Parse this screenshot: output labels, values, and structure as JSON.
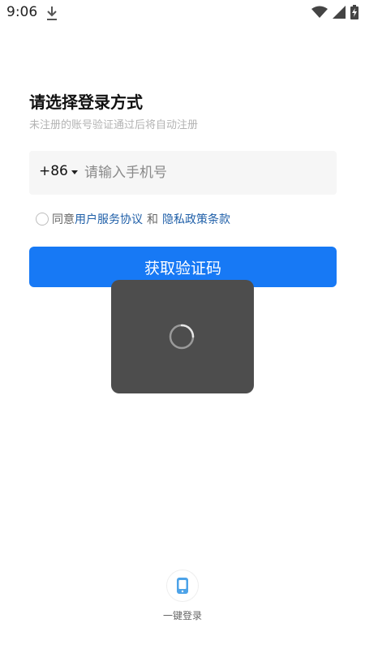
{
  "status_bar": {
    "time": "9:06",
    "icons": [
      "download-icon",
      "wifi-icon",
      "cell-signal-icon",
      "battery-charging-icon"
    ]
  },
  "login": {
    "title": "请选择登录方式",
    "subtitle": "未注册的账号验证通过后将自动注册",
    "country_code": "+86",
    "phone_placeholder": "请输入手机号",
    "agreement": {
      "prefix": "同意",
      "terms_link": "用户服务协议",
      "connector": "和",
      "privacy_link": "隐私政策条款",
      "checked": false
    },
    "primary_button": "获取验证码"
  },
  "loading": {
    "visible": true,
    "icon": "spinner-icon"
  },
  "alt_login": {
    "icon": "phone-icon",
    "label": "一键登录"
  },
  "colors": {
    "accent": "#1779f5",
    "link": "#1f5fa8",
    "overlay": "#4d4d4d",
    "input_bg": "#f6f6f6"
  }
}
